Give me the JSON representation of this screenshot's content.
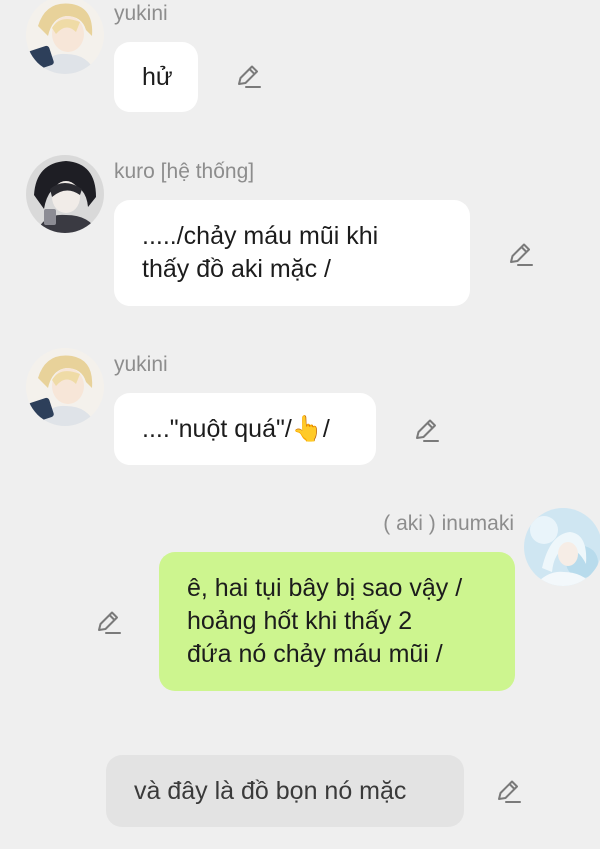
{
  "messages": [
    {
      "sender": "yukini",
      "text": "hử",
      "side": "left",
      "edit_icon": "pencil-edit-icon"
    },
    {
      "sender": "kuro [hệ thống]",
      "text": "...../chảy máu mũi khi\nthấy đồ aki mặc /",
      "side": "left",
      "edit_icon": "pencil-edit-icon"
    },
    {
      "sender": "yukini",
      "text": "....\"nuột quá\"/👆/",
      "side": "left",
      "edit_icon": "pencil-edit-icon"
    },
    {
      "sender": "( aki ) inumaki",
      "text": "ê, hai tụi bây bị sao vậy /\nhoảng hốt khi thấy 2\nđứa nó chảy máu mũi /",
      "side": "right",
      "edit_icon": "pencil-edit-icon"
    },
    {
      "sender": "",
      "text": "và đây là đồ bọn nó mặc",
      "side": "center",
      "edit_icon": "pencil-edit-icon"
    }
  ],
  "colors": {
    "background": "#efefef",
    "bubble_other": "#ffffff",
    "bubble_mine": "#cdf58f",
    "bubble_system": "#e3e3e3",
    "name_text": "#8d8d8d"
  }
}
